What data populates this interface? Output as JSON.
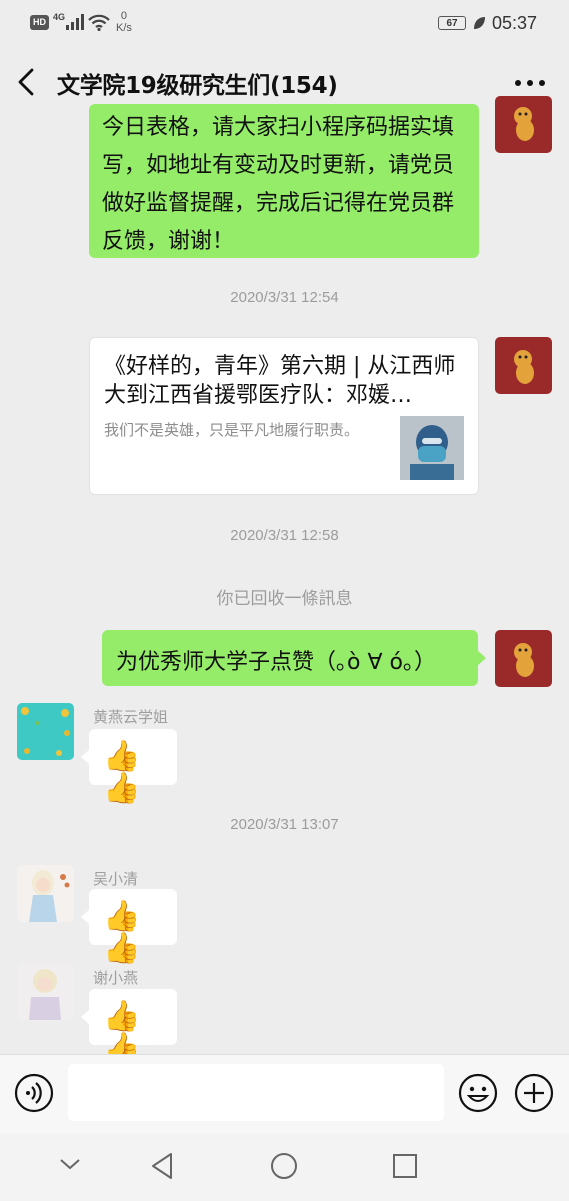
{
  "status_bar": {
    "hd": "HD",
    "network": "4G",
    "speed_value": "0",
    "speed_unit": "K/s",
    "battery": "67",
    "time": "05:37"
  },
  "header": {
    "title": "文学院19级研究生们(154)",
    "back_icon": "chevron-left-icon",
    "more_icon": "ellipsis-icon"
  },
  "messages": {
    "m1_text": "今日表格，请大家扫小程序码据实填写，如地址有变动及时更新，请党员做好监督提醒，完成后记得在党员群反馈，谢谢！",
    "ts1": "2020/3/31 12:54",
    "card_title": "《好样的，青年》第六期 | 从江西师大到江西省援鄂医疗队：邓媛…",
    "card_desc": "我们不是英雄，只是平凡地履行职责。",
    "ts2": "2020/3/31 12:58",
    "recall_notice": "你已回收一條訊息",
    "m3_text": "为优秀师大学子点赞（｡ò ∀ ó｡）",
    "sender1": "黄燕云学姐",
    "ts3": "2020/3/31 13:07",
    "sender2": "吴小清",
    "sender3": "谢小燕",
    "thumbs_emoji": "👍👍"
  },
  "colors": {
    "background": "#ededed",
    "green_bubble": "#95ec69",
    "white_bubble": "#ffffff",
    "my_avatar": "#9a2a2a"
  }
}
